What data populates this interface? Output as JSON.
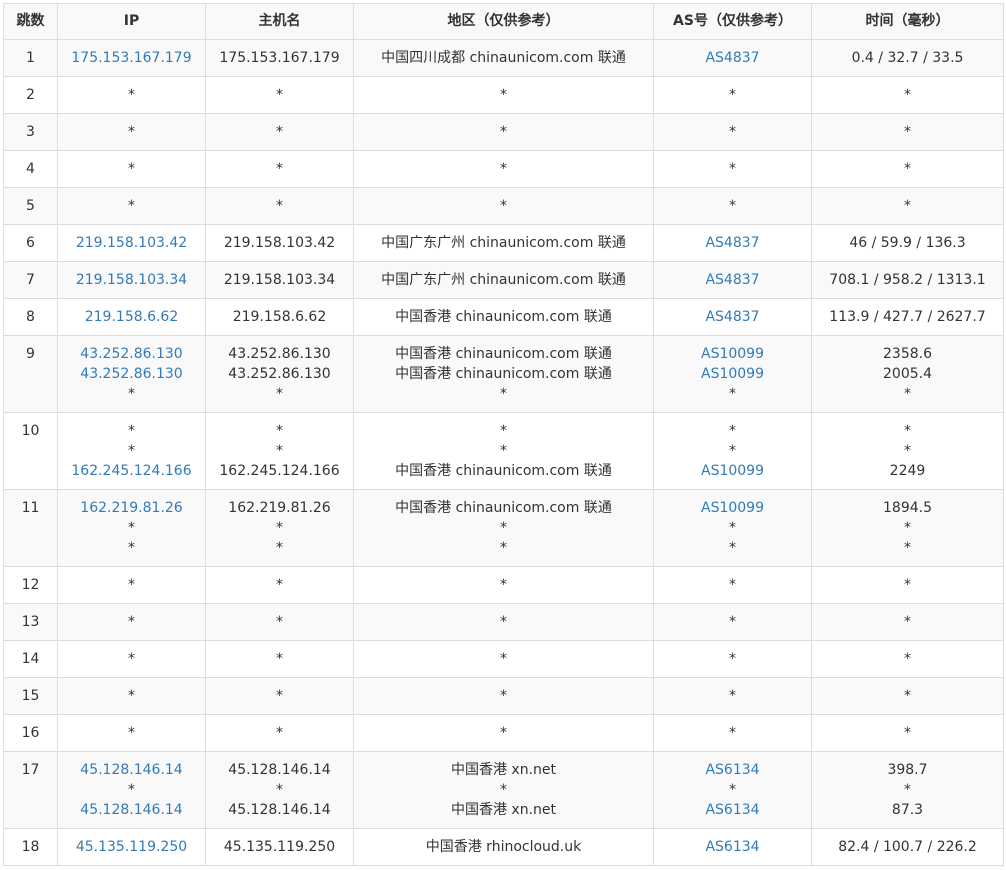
{
  "headers": [
    "跳数",
    "IP",
    "主机名",
    "地区（仅供参考）",
    "AS号（仅供参考）",
    "时间（毫秒）"
  ],
  "rows": [
    {
      "hop": "1",
      "ip": [
        "175.153.167.179"
      ],
      "host": [
        "175.153.167.179"
      ],
      "region": [
        "中国四川成都 chinaunicom.com 联通"
      ],
      "asn": [
        "AS4837"
      ],
      "time": [
        "0.4 / 32.7 / 33.5"
      ]
    },
    {
      "hop": "2",
      "ip": [
        "*"
      ],
      "host": [
        "*"
      ],
      "region": [
        "*"
      ],
      "asn": [
        "*"
      ],
      "time": [
        "*"
      ]
    },
    {
      "hop": "3",
      "ip": [
        "*"
      ],
      "host": [
        "*"
      ],
      "region": [
        "*"
      ],
      "asn": [
        "*"
      ],
      "time": [
        "*"
      ]
    },
    {
      "hop": "4",
      "ip": [
        "*"
      ],
      "host": [
        "*"
      ],
      "region": [
        "*"
      ],
      "asn": [
        "*"
      ],
      "time": [
        "*"
      ]
    },
    {
      "hop": "5",
      "ip": [
        "*"
      ],
      "host": [
        "*"
      ],
      "region": [
        "*"
      ],
      "asn": [
        "*"
      ],
      "time": [
        "*"
      ]
    },
    {
      "hop": "6",
      "ip": [
        "219.158.103.42"
      ],
      "host": [
        "219.158.103.42"
      ],
      "region": [
        "中国广东广州 chinaunicom.com 联通"
      ],
      "asn": [
        "AS4837"
      ],
      "time": [
        "46 / 59.9 / 136.3"
      ]
    },
    {
      "hop": "7",
      "ip": [
        "219.158.103.34"
      ],
      "host": [
        "219.158.103.34"
      ],
      "region": [
        "中国广东广州 chinaunicom.com 联通"
      ],
      "asn": [
        "AS4837"
      ],
      "time": [
        "708.1 / 958.2 / 1313.1"
      ]
    },
    {
      "hop": "8",
      "ip": [
        "219.158.6.62"
      ],
      "host": [
        "219.158.6.62"
      ],
      "region": [
        "中国香港 chinaunicom.com 联通"
      ],
      "asn": [
        "AS4837"
      ],
      "time": [
        "113.9 / 427.7 / 2627.7"
      ]
    },
    {
      "hop": "9",
      "ip": [
        "43.252.86.130",
        "43.252.86.130",
        "*"
      ],
      "host": [
        "43.252.86.130",
        "43.252.86.130",
        "*"
      ],
      "region": [
        "中国香港 chinaunicom.com 联通",
        "中国香港 chinaunicom.com 联通",
        "*"
      ],
      "asn": [
        "AS10099",
        "AS10099",
        "*"
      ],
      "time": [
        "2358.6",
        "2005.4",
        "*"
      ]
    },
    {
      "hop": "10",
      "ip": [
        "*",
        "*",
        "162.245.124.166"
      ],
      "host": [
        "*",
        "*",
        "162.245.124.166"
      ],
      "region": [
        "*",
        "*",
        "中国香港 chinaunicom.com 联通"
      ],
      "asn": [
        "*",
        "*",
        "AS10099"
      ],
      "time": [
        "*",
        "*",
        "2249"
      ]
    },
    {
      "hop": "11",
      "ip": [
        "162.219.81.26",
        "*",
        "*"
      ],
      "host": [
        "162.219.81.26",
        "*",
        "*"
      ],
      "region": [
        "中国香港 chinaunicom.com 联通",
        "*",
        "*"
      ],
      "asn": [
        "AS10099",
        "*",
        "*"
      ],
      "time": [
        "1894.5",
        "*",
        "*"
      ]
    },
    {
      "hop": "12",
      "ip": [
        "*"
      ],
      "host": [
        "*"
      ],
      "region": [
        "*"
      ],
      "asn": [
        "*"
      ],
      "time": [
        "*"
      ]
    },
    {
      "hop": "13",
      "ip": [
        "*"
      ],
      "host": [
        "*"
      ],
      "region": [
        "*"
      ],
      "asn": [
        "*"
      ],
      "time": [
        "*"
      ]
    },
    {
      "hop": "14",
      "ip": [
        "*"
      ],
      "host": [
        "*"
      ],
      "region": [
        "*"
      ],
      "asn": [
        "*"
      ],
      "time": [
        "*"
      ]
    },
    {
      "hop": "15",
      "ip": [
        "*"
      ],
      "host": [
        "*"
      ],
      "region": [
        "*"
      ],
      "asn": [
        "*"
      ],
      "time": [
        "*"
      ]
    },
    {
      "hop": "16",
      "ip": [
        "*"
      ],
      "host": [
        "*"
      ],
      "region": [
        "*"
      ],
      "asn": [
        "*"
      ],
      "time": [
        "*"
      ]
    },
    {
      "hop": "17",
      "ip": [
        "45.128.146.14",
        "*",
        "45.128.146.14"
      ],
      "host": [
        "45.128.146.14",
        "*",
        "45.128.146.14"
      ],
      "region": [
        "中国香港 xn.net",
        "*",
        "中国香港 xn.net"
      ],
      "asn": [
        "AS6134",
        "*",
        "AS6134"
      ],
      "time": [
        "398.7",
        "*",
        "87.3"
      ]
    },
    {
      "hop": "18",
      "ip": [
        "45.135.119.250"
      ],
      "host": [
        "45.135.119.250"
      ],
      "region": [
        "中国香港 rhinocloud.uk"
      ],
      "asn": [
        "AS6134"
      ],
      "time": [
        "82.4 / 100.7 / 226.2"
      ]
    }
  ],
  "colors": {
    "link": "#337ab7",
    "text": "#333333",
    "border": "#dddddd",
    "stripe": "#f9f9f9"
  }
}
